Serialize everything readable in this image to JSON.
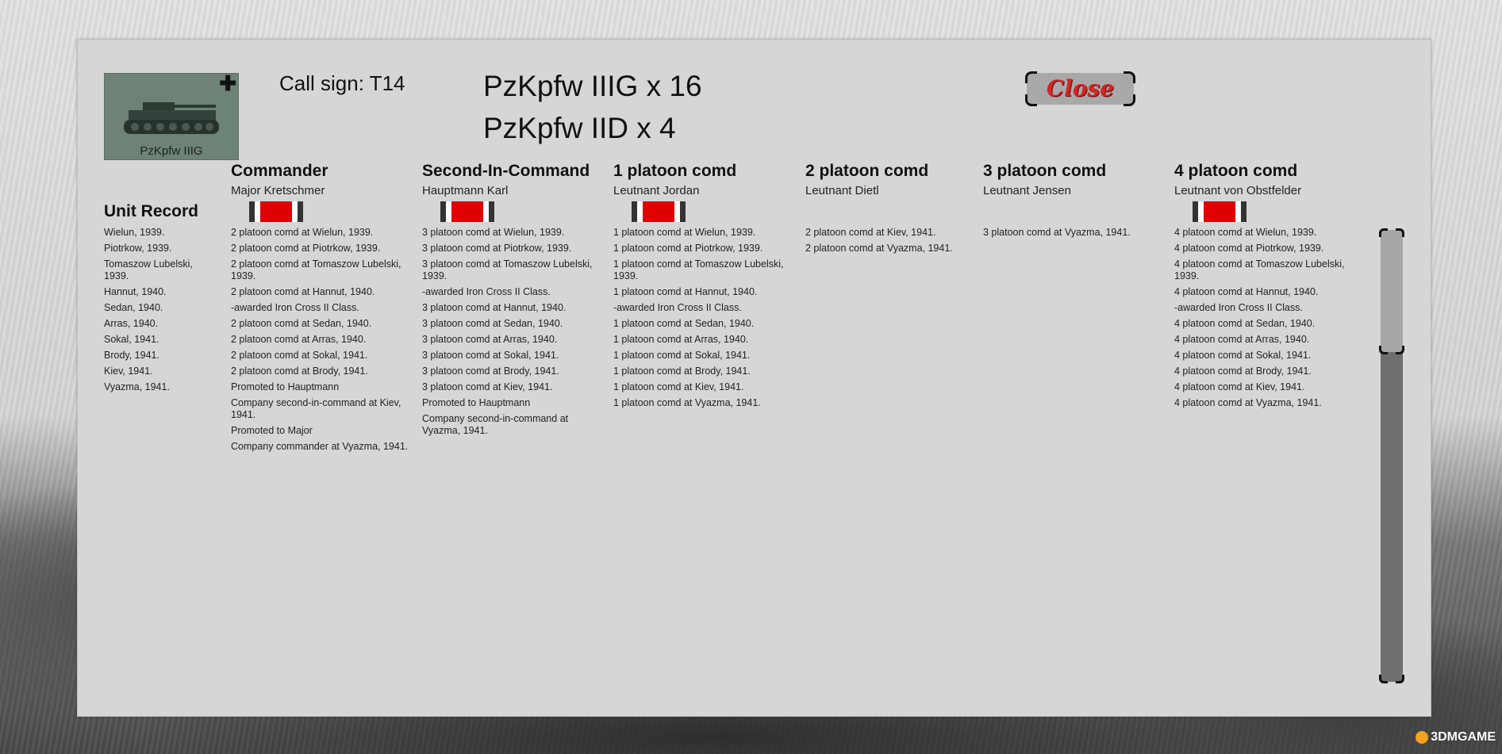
{
  "unit": {
    "thumbnail_label": "PzKpfw IIIG",
    "call_sign": "Call sign: T14",
    "composition": [
      "PzKpfw IIIG x 16",
      "PzKpfw IID x 4"
    ]
  },
  "close_button": {
    "label": "Close"
  },
  "unit_record": {
    "title": "Unit Record",
    "entries": [
      "Wielun, 1939.",
      "Piotrkow, 1939.",
      "Tomaszow Lubelski, 1939.",
      "Hannut, 1940.",
      "Sedan, 1940.",
      "Arras, 1940.",
      "Sokal, 1941.",
      "Brody, 1941.",
      "Kiev, 1941.",
      "Vyazma, 1941."
    ]
  },
  "commanders": [
    {
      "title": "Commander",
      "name": "Major Kretschmer",
      "has_ribbon": true,
      "records": [
        "2 platoon comd at Wielun, 1939.",
        "2 platoon comd at Piotrkow, 1939.",
        "2 platoon comd at Tomaszow Lubelski, 1939.",
        "2 platoon comd at Hannut, 1940.",
        "-awarded Iron Cross II Class.",
        "2 platoon comd at Sedan, 1940.",
        "2 platoon comd at Arras, 1940.",
        "2 platoon comd at Sokal, 1941.",
        "2 platoon comd at Brody, 1941.",
        "Promoted to Hauptmann",
        "Company second-in-command at Kiev, 1941.",
        "Promoted to Major",
        "Company commander at Vyazma, 1941."
      ]
    },
    {
      "title": "Second-In-Command",
      "name": "Hauptmann Karl",
      "has_ribbon": true,
      "records": [
        "3 platoon comd at Wielun, 1939.",
        "3 platoon comd at Piotrkow, 1939.",
        "3 platoon comd at Tomaszow Lubelski, 1939.",
        "-awarded Iron Cross II Class.",
        "3 platoon comd at Hannut, 1940.",
        "3 platoon comd at Sedan, 1940.",
        "3 platoon comd at Arras, 1940.",
        "3 platoon comd at Sokal, 1941.",
        "3 platoon comd at Brody, 1941.",
        "3 platoon comd at Kiev, 1941.",
        "Promoted to Hauptmann",
        "Company second-in-command at Vyazma, 1941."
      ]
    },
    {
      "title": "1 platoon comd",
      "name": "Leutnant Jordan",
      "has_ribbon": true,
      "records": [
        "1 platoon comd at Wielun, 1939.",
        "1 platoon comd at Piotrkow, 1939.",
        "1 platoon comd at Tomaszow Lubelski, 1939.",
        "1 platoon comd at Hannut, 1940.",
        "-awarded Iron Cross II Class.",
        "1 platoon comd at Sedan, 1940.",
        "1 platoon comd at Arras, 1940.",
        "1 platoon comd at Sokal, 1941.",
        "1 platoon comd at Brody, 1941.",
        "1 platoon comd at Kiev, 1941.",
        "1 platoon comd at Vyazma, 1941."
      ]
    },
    {
      "title": "2 platoon comd",
      "name": "Leutnant Dietl",
      "has_ribbon": false,
      "records": [
        "2 platoon comd at Kiev, 1941.",
        "2 platoon comd at Vyazma, 1941."
      ]
    },
    {
      "title": "3 platoon comd",
      "name": "Leutnant Jensen",
      "has_ribbon": false,
      "records": [
        "3 platoon comd at Vyazma, 1941."
      ]
    },
    {
      "title": "4 platoon comd",
      "name": "Leutnant von Obstfelder",
      "has_ribbon": true,
      "records": [
        "4 platoon comd at Wielun, 1939.",
        "4 platoon comd at Piotrkow, 1939.",
        "4 platoon comd at Tomaszow Lubelski, 1939.",
        "4 platoon comd at Hannut, 1940.",
        "-awarded Iron Cross II Class.",
        "4 platoon comd at Sedan, 1940.",
        "4 platoon comd at Arras, 1940.",
        "4 platoon comd at Sokal, 1941.",
        "4 platoon comd at Brody, 1941.",
        "4 platoon comd at Kiev, 1941.",
        "4 platoon comd at Vyazma, 1941."
      ]
    }
  ],
  "scroll": {
    "position": 0
  },
  "watermark": "3DMGAME",
  "colors": {
    "panel": "#d6d6d6",
    "ribbon_red": "#e00000",
    "close_text": "#d22525",
    "thumbnail_bg": "#6d8375"
  },
  "icons": {
    "thumbnail": "tank-icon",
    "cross": "iron-cross-icon",
    "ribbon": "iron-cross-ribbon-icon"
  }
}
